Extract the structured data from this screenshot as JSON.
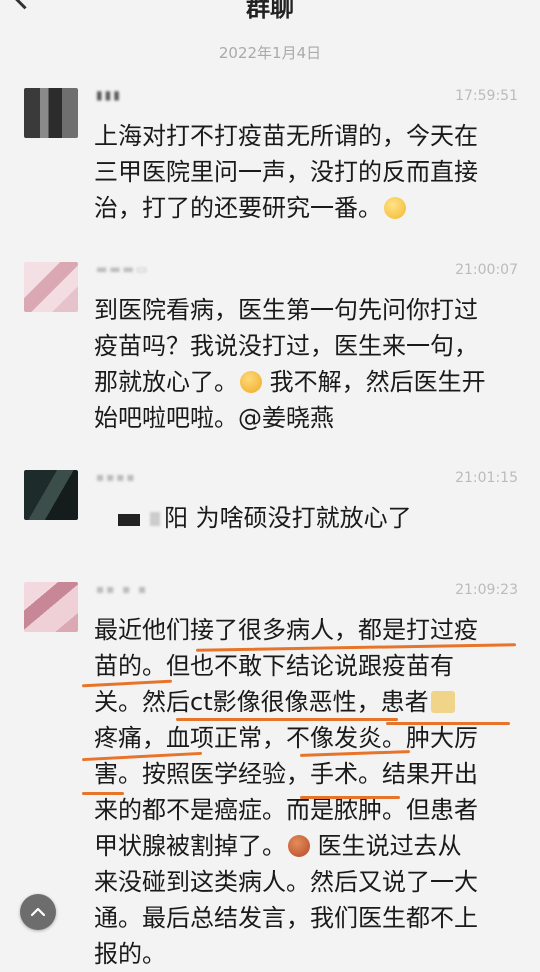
{
  "header": {
    "title": "群聊",
    "back_icon": "chevron-left-icon",
    "more_icon": "more-icon"
  },
  "date": "2022年1月4日",
  "messages": [
    {
      "name": "▮▮▮",
      "time": "17:59:51",
      "lines": [
        "上海对打不打疫苗无所谓的，今天在",
        "三甲医院里问一声，没打的反而直接",
        "治，打了的还要研究一番。"
      ]
    },
    {
      "name": "▬▬▬▭",
      "time": "21:00:07",
      "lines": [
        "到医院看病，医生第一句先问你打过",
        "疫苗吗？我说没打过，医生来一句，",
        "那就放心了。",
        " 我不解，然后医生开",
        "始吧啦吧啦。@姜晓燕"
      ]
    },
    {
      "name": "▪▪▪▪",
      "time": "21:01:15",
      "lines": [
        "阳 为啥硕没打就放心了"
      ]
    },
    {
      "name": "▪▪ ▪ ▪",
      "time": "21:09:23",
      "lines": [
        "最近他们接了很多病人，都是打过疫",
        "苗的。但也不敢下结论说跟疫苗有",
        "关。然后ct影像很像恶性，患者",
        "疼痛，血项正常，不像发炎。肿大厉",
        "害。按照医学经验，手术。结果开出",
        "来的都不是癌症。而是脓肿。但患者",
        "甲状腺被割掉了。",
        " 医生说过去从",
        "来没碰到这类病人。然后又说了一大",
        "通。最后总结发言，我们医生都不上",
        "报的。"
      ]
    }
  ],
  "scroll_top_icon": "arrow-up-icon"
}
